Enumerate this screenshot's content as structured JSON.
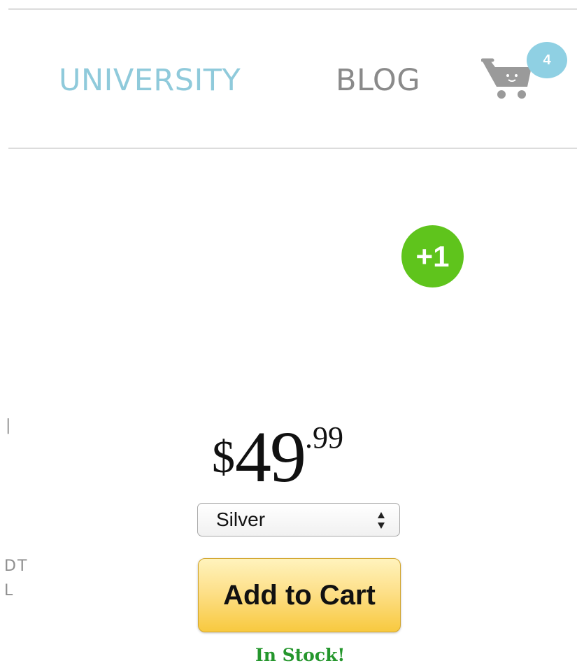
{
  "nav": {
    "university": "UNIVERSITY",
    "blog": "BLOG"
  },
  "cart": {
    "icon": "cart-icon",
    "count": "4"
  },
  "social": {
    "plus_one": "+1"
  },
  "fragments": {
    "left_line_1": "DT",
    "left_line_2": "L"
  },
  "product": {
    "price_currency": "$",
    "price_whole": "49",
    "price_cents": ".99",
    "variant_selected": "Silver",
    "add_to_cart_label": "Add to Cart",
    "availability": "In Stock!"
  },
  "colors": {
    "nav_active": "#8fcadb",
    "nav_inactive": "#8a8a8a",
    "cart_badge": "#8fd0e3",
    "plus_one": "#5fc41c",
    "in_stock": "#24962c",
    "add_to_cart": "#f8c93f"
  }
}
